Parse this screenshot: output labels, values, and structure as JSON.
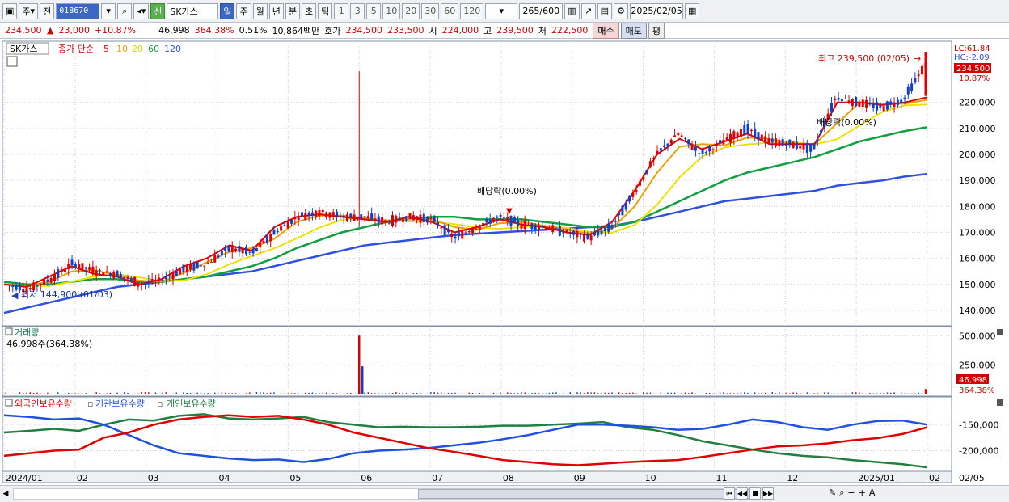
{
  "toolbar": {
    "period_type": "주",
    "prev_label": "전",
    "code": "018670",
    "badge": "신",
    "name": "SK가스",
    "timeframes": [
      "일",
      "주",
      "월",
      "년",
      "분",
      "초",
      "틱"
    ],
    "active_timeframe": "일",
    "intervals": [
      "1",
      "3",
      "5",
      "10",
      "20",
      "30",
      "60",
      "120"
    ],
    "count": "265",
    "count_max": "/600",
    "date": "2025/02/05"
  },
  "infobar": {
    "price": "234,500",
    "change": "23,000",
    "change_pct": "+10.87%",
    "volume": "46,998",
    "vol_ratio": "364.38%",
    "turnover": "0.51%",
    "amount": "10,864백만",
    "ask_label": "호가",
    "ask": "234,500",
    "bid": "233,500",
    "open_label": "시",
    "open": "224,000",
    "high_label": "고",
    "high": "239,500",
    "low_label": "저",
    "low": "222,500",
    "buy": "매수",
    "sell": "매도",
    "avg": "평"
  },
  "legend": {
    "name": "SK가스",
    "ma_label": "종가 단순",
    "ma_periods": [
      "5",
      "10",
      "20",
      "60",
      "120"
    ],
    "ma_colors": [
      "#e00000",
      "#f0a000",
      "#f0e000",
      "#10a040",
      "#3050e0"
    ]
  },
  "price_panel": {
    "lc": "LC:61.84",
    "hc": "HC:-2.09",
    "current_price_tag": "234,500",
    "current_pct_tag": "10.87%",
    "high_annotation": "최고 239,500 (02/05)",
    "low_annotation": "최저 144,900 (01/03)",
    "dividend_1": "배당락(0.00%)",
    "dividend_2": "배당락(0.00%)",
    "y_ticks": [
      "220,000",
      "210,000",
      "200,000",
      "190,000",
      "180,000",
      "170,000",
      "160,000",
      "150,000",
      "140,000"
    ]
  },
  "volume_panel": {
    "title": "거래량",
    "readout": "46,998주(364.38%)",
    "y_ticks": [
      "500,000",
      "250,000"
    ],
    "current_tag": "46,998",
    "current_pct": "364.38%"
  },
  "holdings_panel": {
    "labels": [
      "외국인보유수량",
      "기관보유수량",
      "개인보유수량"
    ],
    "colors": [
      "#e00000",
      "#2050e0",
      "#208040"
    ],
    "y_ticks": [
      "-150,000",
      "-200,000"
    ]
  },
  "x_axis": {
    "labels": [
      "2024/01",
      "02",
      "03",
      "04",
      "05",
      "06",
      "07",
      "08",
      "09",
      "10",
      "11",
      "12",
      "2025/01",
      "02"
    ],
    "right_label": "02/05"
  },
  "chart_data": [
    {
      "type": "candlestick",
      "title": "SK가스",
      "ylim": [
        135000,
        242000
      ],
      "months": [
        "2024/01",
        "02",
        "03",
        "04",
        "05",
        "06",
        "07",
        "08",
        "09",
        "10",
        "11",
        "12",
        "2025/01",
        "02"
      ],
      "close_path": [
        150000,
        148000,
        152000,
        158000,
        155000,
        154000,
        150000,
        152000,
        156000,
        158000,
        164000,
        162000,
        170000,
        176000,
        178000,
        176000,
        176000,
        174000,
        176000,
        175000,
        168000,
        172000,
        176000,
        173000,
        172000,
        170000,
        168000,
        172000,
        185000,
        200000,
        208000,
        200000,
        205000,
        210000,
        205000,
        204000,
        202000,
        222000,
        220000,
        218000,
        221000,
        234500
      ],
      "ma": {
        "5": [
          150000,
          149000,
          153000,
          157000,
          154000,
          153000,
          150000,
          152000,
          157000,
          160000,
          165000,
          163000,
          172000,
          176000,
          177000,
          176000,
          175000,
          174000,
          176000,
          174000,
          170000,
          172000,
          175000,
          173000,
          172000,
          170000,
          169000,
          174000,
          186000,
          200000,
          206000,
          202000,
          205000,
          208000,
          204000,
          204000,
          204000,
          220000,
          220000,
          219000,
          220000,
          222000
        ],
        "60": [
          151000,
          150000,
          150000,
          151000,
          152000,
          152000,
          151000,
          151000,
          152000,
          153000,
          155000,
          157000,
          160000,
          164000,
          167000,
          170000,
          172000,
          174000,
          175000,
          176000,
          176000,
          175000,
          175000,
          175000,
          174000,
          173000,
          172000,
          172000,
          174000,
          178000,
          182000,
          186000,
          190000,
          193000,
          195000,
          197000,
          199000,
          202000,
          205000,
          207000,
          209000,
          210500
        ],
        "120": [
          139000,
          141000,
          143000,
          145000,
          147000,
          149000,
          150000,
          151000,
          152000,
          153000,
          154000,
          155000,
          157000,
          159000,
          161000,
          163000,
          165000,
          166000,
          167000,
          168000,
          169000,
          169500,
          170000,
          170500,
          171000,
          171500,
          172000,
          172500,
          174000,
          176000,
          178000,
          180000,
          182000,
          183000,
          184000,
          185000,
          186000,
          188000,
          189000,
          190000,
          191500,
          192500
        ]
      },
      "high": 239500,
      "low": 144900
    },
    {
      "type": "bar",
      "title": "거래량",
      "ylim": [
        0,
        550000
      ],
      "spikes": [
        {
          "month": "06",
          "value": 500000
        }
      ],
      "last": 46998
    },
    {
      "type": "line",
      "ylim": [
        -235000,
        -120000
      ],
      "series": [
        {
          "name": "외국인보유수량",
          "values": [
            -210000,
            -205000,
            -200000,
            -198000,
            -175000,
            -165000,
            -150000,
            -140000,
            -135000,
            -132000,
            -135000,
            -133000,
            -140000,
            -150000,
            -165000,
            -175000,
            -185000,
            -195000,
            -202000,
            -210000,
            -218000,
            -222000,
            -226000,
            -228000,
            -225000,
            -222000,
            -220000,
            -218000,
            -212000,
            -205000,
            -198000,
            -192000,
            -190000,
            -186000,
            -180000,
            -176000,
            -168000,
            -155000
          ]
        },
        {
          "name": "기관보유수량",
          "values": [
            -132000,
            -135000,
            -140000,
            -138000,
            -150000,
            -170000,
            -190000,
            -205000,
            -210000,
            -215000,
            -218000,
            -217000,
            -222000,
            -216000,
            -205000,
            -200000,
            -198000,
            -195000,
            -190000,
            -185000,
            -178000,
            -170000,
            -160000,
            -150000,
            -150000,
            -152000,
            -155000,
            -160000,
            -158000,
            -150000,
            -140000,
            -145000,
            -155000,
            -160000,
            -150000,
            -143000,
            -142000,
            -150000
          ]
        },
        {
          "name": "개인보유수량",
          "values": [
            -165000,
            -162000,
            -158000,
            -162000,
            -150000,
            -140000,
            -142000,
            -133000,
            -130000,
            -138000,
            -140000,
            -138000,
            -135000,
            -145000,
            -150000,
            -155000,
            -154000,
            -155000,
            -155000,
            -154000,
            -152000,
            -152000,
            -150000,
            -148000,
            -145000,
            -155000,
            -160000,
            -170000,
            -182000,
            -190000,
            -198000,
            -205000,
            -210000,
            -213000,
            -218000,
            -222000,
            -226000,
            -232000
          ]
        }
      ]
    }
  ]
}
